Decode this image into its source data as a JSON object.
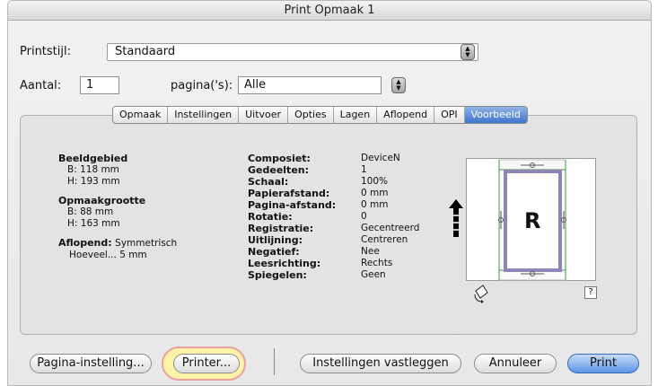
{
  "window": {
    "title": "Print Opmaak 1"
  },
  "printstijl": {
    "label": "Printstijl:",
    "value": "Standaard"
  },
  "aantal": {
    "label": "Aantal:",
    "value": "1"
  },
  "paginas": {
    "label": "pagina('s):",
    "value": "Alle"
  },
  "tabs": [
    "Opmaak",
    "Instellingen",
    "Uitvoer",
    "Opties",
    "Lagen",
    "Aflopend",
    "OPI",
    "Voorbeeld"
  ],
  "active_tab": "Voorbeeld",
  "left_info": {
    "beeldgebied_title": "Beeldgebied",
    "beeldgebied_b": "B: 118 mm",
    "beeldgebied_h": "H: 193 mm",
    "opmaakgrootte_title": "Opmaakgrootte",
    "opmaakgrootte_b": "B: 88 mm",
    "opmaakgrootte_h": "H: 163 mm",
    "aflopend_label": "Aflopend:",
    "aflopend_value": "Symmetrisch",
    "hoeveel": "Hoeveel...",
    "hoeveel_value": "5 mm"
  },
  "mid_info": [
    {
      "label": "Composiet:",
      "value": "DeviceN"
    },
    {
      "label": "Gedeelten:",
      "value": "1"
    },
    {
      "label": "Schaal:",
      "value": "100%"
    },
    {
      "label": "Papierafstand:",
      "value": "0 mm"
    },
    {
      "label": "Pagina-afstand:",
      "value": "0 mm"
    },
    {
      "label": "Rotatie:",
      "value": "0"
    },
    {
      "label": "Registratie:",
      "value": "Gecentreerd"
    },
    {
      "label": "Uitlijning:",
      "value": "Centreren"
    },
    {
      "label": "Negatief:",
      "value": "Nee"
    },
    {
      "label": "Leesrichting:",
      "value": "Rechts"
    },
    {
      "label": "Spiegelen:",
      "value": "Geen"
    }
  ],
  "preview": {
    "letter": "R",
    "help": "?"
  },
  "buttons": {
    "pagina_instelling": "Pagina-instelling...",
    "printer": "Printer...",
    "instellingen_vastleggen": "Instellingen vastleggen",
    "annuleer": "Annuleer",
    "print": "Print"
  },
  "colors": {
    "accent": "#3d74cd",
    "highlight": "#fff3a8",
    "guide": "#3c9a3c"
  }
}
